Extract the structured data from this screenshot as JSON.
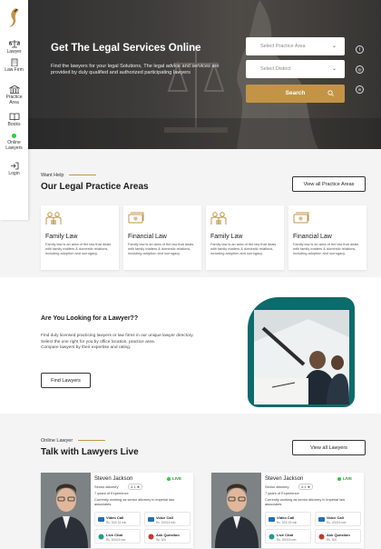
{
  "sidebar": {
    "items": [
      {
        "label": "Lawyer",
        "icon": "scales-icon"
      },
      {
        "label": "Law Firm",
        "icon": "building-icon"
      },
      {
        "label": "Practice Area",
        "icon": "courthouse-icon"
      },
      {
        "label": "Books",
        "icon": "book-icon"
      },
      {
        "label": "Online Lawyers",
        "icon": "online-dot-icon"
      },
      {
        "label": "Login",
        "icon": "login-icon"
      }
    ]
  },
  "hero": {
    "title": "Get The Legal Services Online",
    "description": "Find the lawyers for your legal Solutions, The legal advice and services are provided by duly qualified and authorized participating lawyers",
    "practice_area_placeholder": "Select Practice Area",
    "district_placeholder": "Select District",
    "search_label": "Search",
    "social": [
      "f",
      "◎",
      "in"
    ]
  },
  "practice": {
    "eyebrow": "Want Help",
    "title": "Our Legal Practice Areas",
    "view_all": "View all Practice Areas",
    "cards": [
      {
        "title": "Family Law",
        "text": "Family law is an area of the law that deals with family matters & domestic relations, including adoption and surrogacy.",
        "icon": "family-icon"
      },
      {
        "title": "Financial Law",
        "text": "Family law is an area of the law that deals with family matters & domestic relations, including adoption and surrogacy.",
        "icon": "money-icon"
      },
      {
        "title": "Family Law",
        "text": "Family law is an area of the law that deals with family matters & domestic relations, including adoption and surrogacy.",
        "icon": "family-icon"
      },
      {
        "title": "Financial Law",
        "text": "Family law is an area of the law that deals with family matters & domestic relations, including adoption and surrogacy.",
        "icon": "money-icon"
      }
    ]
  },
  "looking": {
    "title": "Are You Looking for a Lawyer??",
    "line1": "Find duly licensed practicing lawyers or law firms in our unique lawyer directory.",
    "line2": "Select the one right for you by office location, practice area.",
    "line3": "Compare lawyers by their expertise and rating.",
    "button": "Find Lawyers"
  },
  "talk": {
    "eyebrow": "Online Lawyer",
    "title": "Talk with Lawyers Live",
    "view_all": "View all Lawyers",
    "lawyers": [
      {
        "name": "Steven Jackson",
        "status": "LIVE",
        "role": "Senior attorney",
        "rating": "4.1 ★",
        "experience": "7 years of Experience",
        "description": "Currently working as senior attorney in imperial law associates.",
        "services": [
          {
            "title": "Video Call",
            "price": "Rs. 300/ 15 min",
            "color": "#1f6fb5"
          },
          {
            "title": "Voice Call",
            "price": "Rs. 200/15 min",
            "color": "#1f6fb5"
          },
          {
            "title": "Live Chat",
            "price": "Rs. 300/15 min",
            "color": "#1f9a8f"
          },
          {
            "title": "Ask Question",
            "price": "Rs. 300",
            "color": "#c0392b"
          }
        ]
      },
      {
        "name": "Steven Jackson",
        "status": "LIVE",
        "role": "Senior attorney",
        "rating": "4.1 ★",
        "experience": "7 years of Experience",
        "description": "Currently working as senior attorney in imperial law associates.",
        "services": [
          {
            "title": "Video Call",
            "price": "Rs. 300/ 15 min",
            "color": "#1f6fb5"
          },
          {
            "title": "Voice Call",
            "price": "Rs. 200/15 min",
            "color": "#1f6fb5"
          },
          {
            "title": "Live Chat",
            "price": "Rs. 300/15 min",
            "color": "#1f9a8f"
          },
          {
            "title": "Ask Question",
            "price": "Rs. 300",
            "color": "#c0392b"
          }
        ]
      }
    ]
  },
  "colors": {
    "accent": "#c39446",
    "teal": "#0c6b6b",
    "live": "#2ecc40"
  }
}
